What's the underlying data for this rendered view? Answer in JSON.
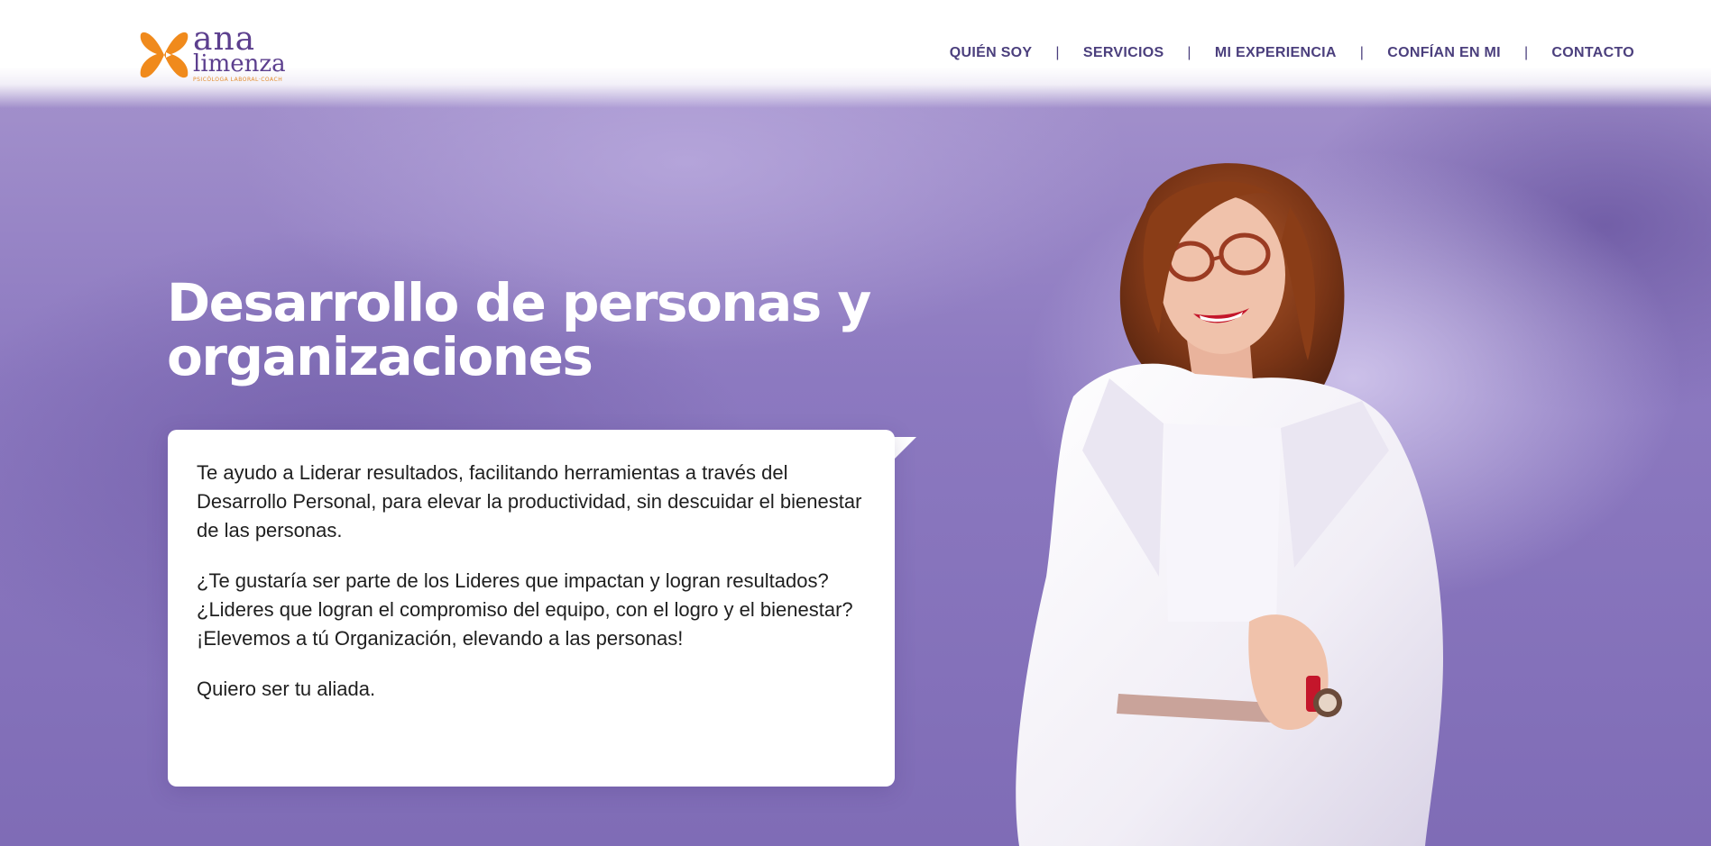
{
  "brand": {
    "logo_line1": "ana",
    "logo_line2": "limenza",
    "logo_tagline": "PSICÓLOGA LABORAL·COACH",
    "colors": {
      "purple": "#5c3f8e",
      "orange": "#f08a1c",
      "nav": "#4b3f7d"
    },
    "logo_icon": "butterfly-icon"
  },
  "nav": {
    "items": [
      "QUIÉN SOY",
      "SERVICIOS",
      "MI EXPERIENCIA",
      "CONFÍAN EN MI",
      "CONTACTO"
    ],
    "separator": "|"
  },
  "hero": {
    "title_line1": "Desarrollo de personas y",
    "title_line2": "organizaciones",
    "paragraph1": "Te ayudo a Liderar resultados, facilitando herramientas a través del Desarrollo Personal, para elevar la productividad, sin descuidar el bienestar de las personas.",
    "question1": "¿Te gustaría ser parte de los Lideres que impactan y logran resultados?",
    "question2": "¿Lideres que logran el compromiso del equipo, con el logro y el bienestar?",
    "exclamation": "¡Elevemos a tú Organización, elevando a las personas!",
    "closing": "Quiero ser tu aliada."
  }
}
